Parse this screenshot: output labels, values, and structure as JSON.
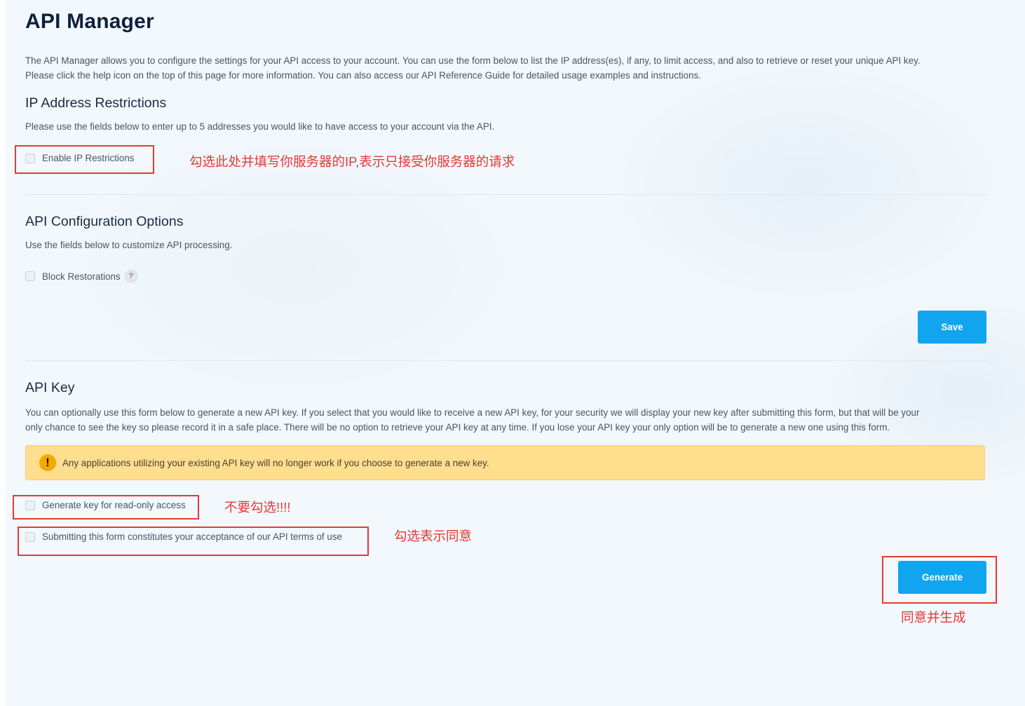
{
  "page": {
    "title": "API Manager",
    "intro_line1": "The API Manager allows you to configure the settings for your API access to your account. You can use the form below to list the IP address(es), if any, to limit access, and also to retrieve or reset your unique API key.",
    "intro_line2": "Please click the help icon on the top of this page for more information. You can also access our API Reference Guide for detailed usage examples and instructions."
  },
  "ip_restrictions": {
    "title": "IP Address Restrictions",
    "description": "Please use the fields below to enter up to 5 addresses you would like to have access to your account via the API.",
    "enable_label": "Enable IP Restrictions"
  },
  "config": {
    "title": "API Configuration Options",
    "description": "Use the fields below to customize API processing.",
    "block_label": "Block Restorations",
    "help_glyph": "?",
    "save_label": "Save"
  },
  "api_key": {
    "title": "API Key",
    "description_line1": "You can optionally use this form below to generate a new API key. If you select that you would like to receive a new API key, for your security we will display your new key after submitting this form, but that will be your",
    "description_line2": "only chance to see the key so please record it in a safe place. There will be no option to retrieve your API key at any time. If you lose your API key your only option will be to generate a new one using this form.",
    "warning_glyph": "!",
    "warning": "Any applications utilizing your existing API key will no longer work if you choose to generate a new key.",
    "readonly_label": "Generate key for read-only access",
    "terms_label": "Submitting this form constitutes your acceptance of our API terms of use",
    "generate_label": "Generate"
  },
  "annotations": {
    "ip_note": "勾选此处并填写你服务器的IP,表示只接受你服务器的请求",
    "readonly_note": "不要勾选!!!!",
    "terms_note": "勾选表示同意",
    "generate_note": "同意并生成"
  },
  "colors": {
    "accent": "#10a5ee",
    "warning_bg": "#ffde8e",
    "annotation": "#e53935",
    "title": "#0f1f3d"
  }
}
